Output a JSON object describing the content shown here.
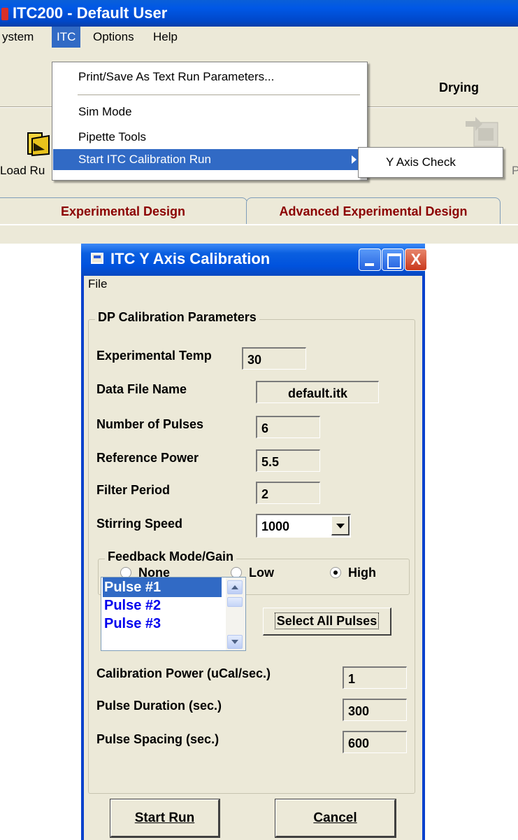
{
  "app": {
    "title": "ITC200 - Default User",
    "menubar": [
      "ystem",
      "ITC",
      "Options",
      "Help"
    ],
    "drying_label": "Drying",
    "load_label": "Load Ru",
    "right_tool_label": "P",
    "tabs": [
      "Experimental Design",
      "Advanced Experimental Design"
    ]
  },
  "itc_menu": {
    "items": [
      "Print/Save As Text Run Parameters...",
      "Sim Mode",
      "Pipette Tools",
      "Start ITC Calibration Run"
    ],
    "submenu": [
      "Y Axis Check"
    ]
  },
  "dialog": {
    "title": "ITC Y Axis Calibration",
    "close_glyph": "X",
    "menu_file": "File",
    "group_title": "DP Calibration Parameters",
    "fields": {
      "exp_temp_label": "Experimental Temp",
      "exp_temp_value": "30",
      "data_file_label": "Data File Name",
      "data_file_value": "default.itk",
      "num_pulses_label": "Number of Pulses",
      "num_pulses_value": "6",
      "ref_power_label": "Reference Power",
      "ref_power_value": "5.5",
      "filter_label": "Filter Period",
      "filter_value": "2",
      "stirring_label": "Stirring Speed",
      "stirring_value": "1000"
    },
    "feedback": {
      "title": "Feedback Mode/Gain",
      "options": [
        "None",
        "Low",
        "High"
      ],
      "selected": "High"
    },
    "pulses": [
      "Pulse #1",
      "Pulse #2",
      "Pulse #3"
    ],
    "select_all_label": "Select All Pulses",
    "calibration": {
      "power_label": "Calibration Power (uCal/sec.)",
      "power_value": "1",
      "duration_label": "Pulse Duration (sec.)",
      "duration_value": "300",
      "spacing_label": "Pulse Spacing (sec.)",
      "spacing_value": "600"
    },
    "start_run_label": "Start Run",
    "cancel_label": "Cancel"
  },
  "colors": {
    "xp_blue": "#0054e3",
    "menu_highlight": "#316ac5",
    "tab_text": "#8b0000",
    "dialog_bg": "#ece9d8"
  }
}
